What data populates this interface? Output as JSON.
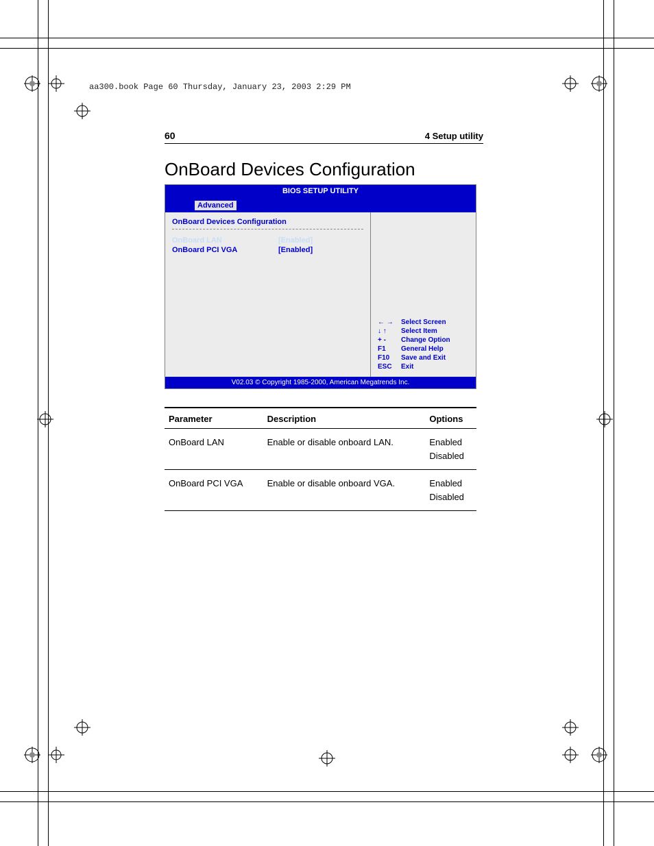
{
  "meta": {
    "file_line": "aa300.book  Page 60  Thursday, January 23, 2003  2:29 PM"
  },
  "header": {
    "page_number": "60",
    "chapter": "4 Setup utility"
  },
  "title": "OnBoard Devices Configuration",
  "bios": {
    "title": "BIOS SETUP UTILITY",
    "active_tab": "Advanced",
    "section_title": "OnBoard Devices Configuration",
    "items": [
      {
        "label": "OnBoard LAN",
        "value": "[Enabled]"
      },
      {
        "label": "OnBoard PCI VGA",
        "value": "[Enabled]"
      }
    ],
    "help_keys": [
      {
        "key": "← →",
        "desc": "Select Screen"
      },
      {
        "key": "↓  ↑",
        "desc": "Select Item"
      },
      {
        "key": "+ -",
        "desc": "Change Option"
      },
      {
        "key": "F1",
        "desc": "General Help"
      },
      {
        "key": "F10",
        "desc": "Save and Exit"
      },
      {
        "key": "ESC",
        "desc": "Exit"
      }
    ],
    "footer": "V02.03 © Copyright 1985-2000, American Megatrends Inc."
  },
  "table": {
    "headers": {
      "param": "Parameter",
      "desc": "Description",
      "opts": "Options"
    },
    "rows": [
      {
        "param": "OnBoard LAN",
        "desc": "Enable or disable onboard LAN.",
        "opts": "Enabled\nDisabled"
      },
      {
        "param": "OnBoard PCI VGA",
        "desc": "Enable or disable onboard VGA.",
        "opts": "Enabled\nDisabled"
      }
    ]
  }
}
